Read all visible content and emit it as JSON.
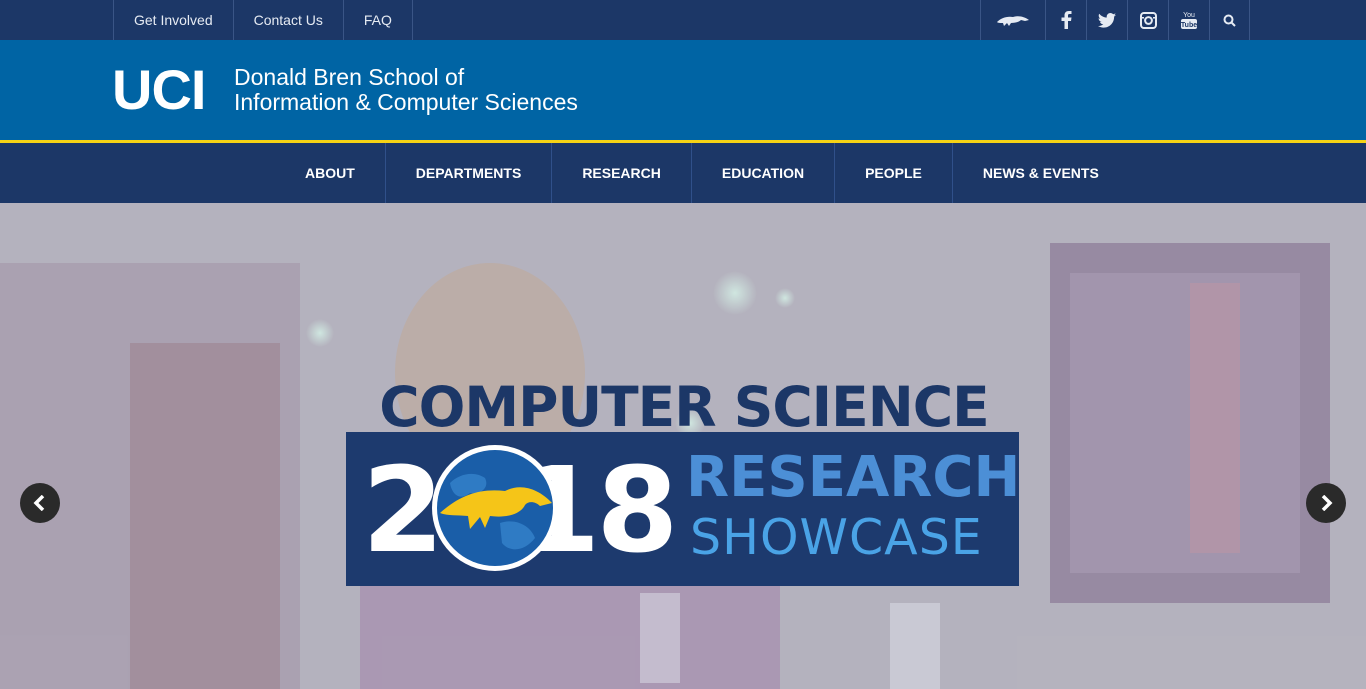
{
  "utility_nav": {
    "links": [
      "Get Involved",
      "Contact Us",
      "FAQ"
    ],
    "social_icons": [
      "anteater-icon",
      "facebook-icon",
      "twitter-icon",
      "instagram-icon",
      "youtube-icon",
      "search-icon"
    ]
  },
  "header": {
    "logo": "UCI",
    "school_line1": "Donald Bren School of",
    "school_line2": "Information & Computer Sciences"
  },
  "main_nav": {
    "items": [
      "ABOUT",
      "DEPARTMENTS",
      "RESEARCH",
      "EDUCATION",
      "PEOPLE",
      "NEWS & EVENTS"
    ]
  },
  "hero": {
    "title_line": "COMPUTER SCIENCE",
    "year": "2018",
    "research": "RESEARCH",
    "showcase": "SHOWCASE",
    "prev_icon": "chevron-left-icon",
    "next_icon": "chevron-right-icon"
  },
  "colors": {
    "navy": "#1c3767",
    "blue": "#0064a4",
    "gold": "#f5d316"
  }
}
